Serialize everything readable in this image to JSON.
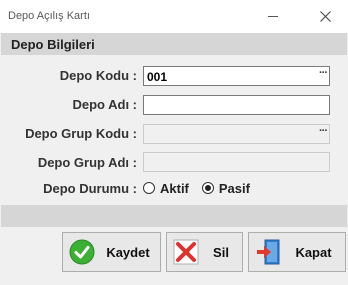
{
  "window": {
    "title": "Depo Açılış Kartı"
  },
  "group": {
    "title": "Depo Bilgileri"
  },
  "fields": {
    "depo_kodu": {
      "label": "Depo Kodu :",
      "value": "001"
    },
    "depo_adi": {
      "label": "Depo Adı :",
      "value": ""
    },
    "depo_grup_kodu": {
      "label": "Depo Grup Kodu :",
      "value": ""
    },
    "depo_grup_adi": {
      "label": "Depo Grup Adı :",
      "value": ""
    },
    "depo_durumu": {
      "label": "Depo Durumu :",
      "options": [
        "Aktif",
        "Pasif"
      ],
      "selected": "Pasif"
    }
  },
  "lookup_label": "···",
  "buttons": {
    "kaydet": "Kaydet",
    "sil": "Sil",
    "kapat": "Kapat"
  },
  "icons": {
    "minimize": "minimize-icon",
    "close": "close-icon",
    "save": "check-circle-icon",
    "delete": "x-box-icon",
    "exit": "exit-door-icon"
  },
  "colors": {
    "save": "#3cb034",
    "delete": "#e0312c",
    "exit_arrow": "#e03a2a",
    "exit_door": "#2f7fd0"
  }
}
